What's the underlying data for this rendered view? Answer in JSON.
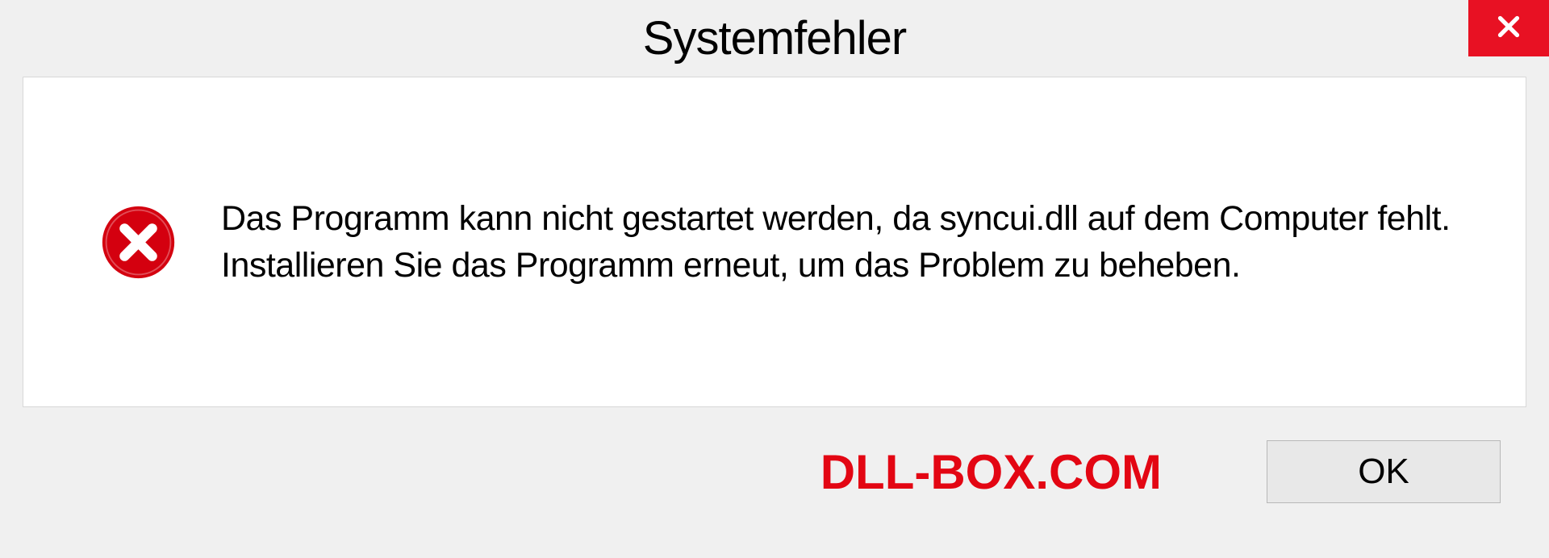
{
  "dialog": {
    "title": "Systemfehler",
    "message": "Das Programm kann nicht gestartet werden, da syncui.dll auf dem Computer fehlt. Installieren Sie das Programm erneut, um das Problem zu beheben.",
    "ok_label": "OK",
    "watermark": "DLL-BOX.COM"
  }
}
